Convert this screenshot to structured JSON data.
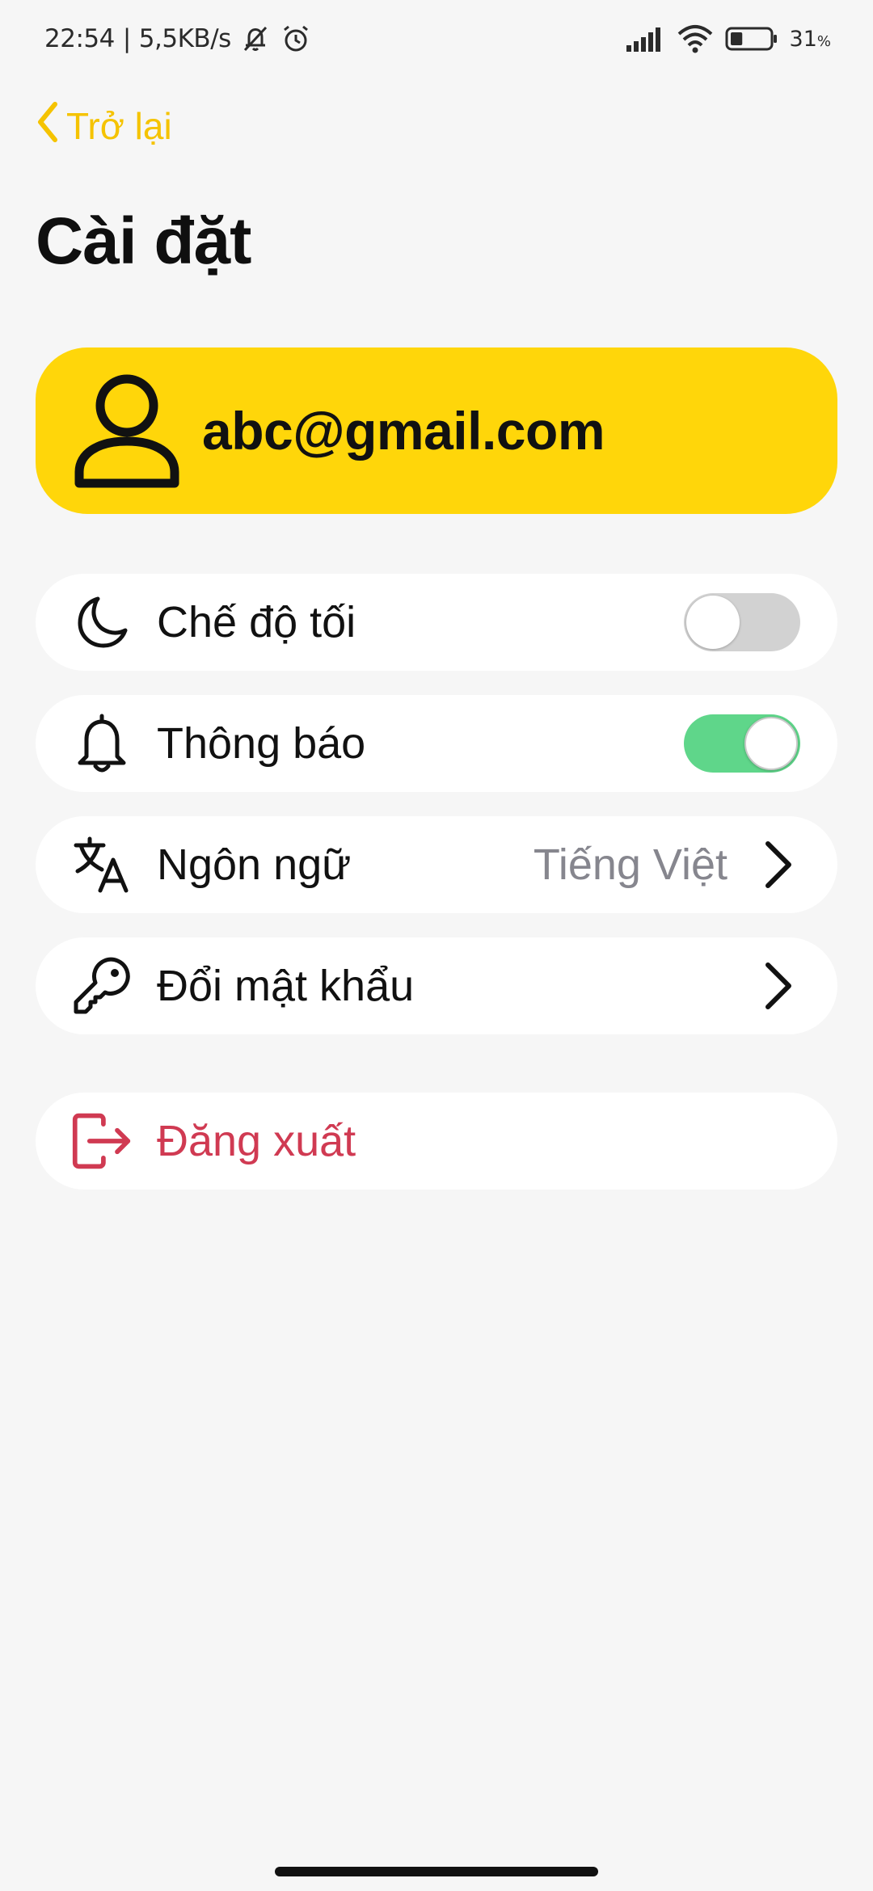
{
  "status_bar": {
    "time": "22:54",
    "separator": "|",
    "network_speed": "5,5KB/s",
    "icons_left": [
      "notification-muted-icon",
      "alarm-icon"
    ],
    "icons_right": [
      "signal-icon",
      "wifi-icon",
      "battery-icon"
    ],
    "battery_percent": "31",
    "battery_unit": "%",
    "battery_level": 0.31
  },
  "nav": {
    "back_label": "Trở lại",
    "back_icon": "chevron-left-icon"
  },
  "page": {
    "title": "Cài đặt"
  },
  "profile": {
    "email": "abc@gmail.com",
    "icon": "user-icon",
    "background": "#ffd60a"
  },
  "settings": {
    "dark_mode": {
      "label": "Chế độ tối",
      "icon": "moon-icon",
      "enabled": false
    },
    "notifications": {
      "label": "Thông báo",
      "icon": "bell-icon",
      "enabled": true
    },
    "language": {
      "label": "Ngôn ngữ",
      "icon": "translate-icon",
      "value": "Tiếng Việt"
    },
    "change_password": {
      "label": "Đổi mật khẩu",
      "icon": "key-icon"
    }
  },
  "logout": {
    "label": "Đăng xuất",
    "icon": "logout-icon",
    "color": "#d03a52"
  },
  "colors": {
    "accent": "#f5c300",
    "background": "#f6f6f6",
    "toggle_on": "#5fd68a",
    "toggle_off": "#d2d2d2",
    "secondary_text": "#86868e"
  }
}
